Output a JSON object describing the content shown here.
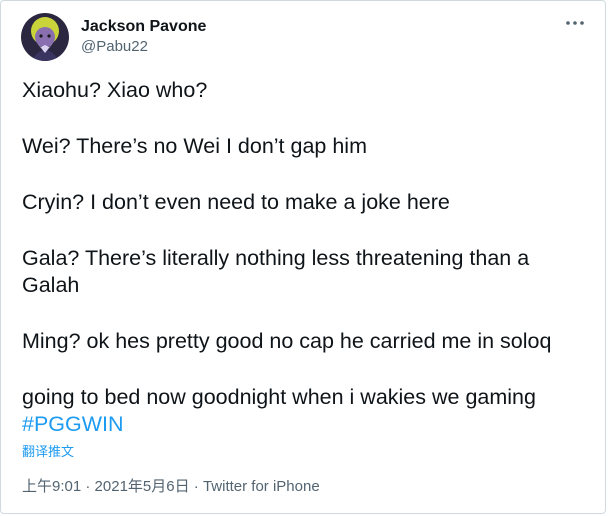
{
  "author": {
    "display_name": "Jackson Pavone",
    "handle": "@Pabu22"
  },
  "tweet": {
    "paragraphs": [
      "Xiaohu? Xiao who?",
      "Wei? There’s no Wei I don’t gap him",
      "Cryin? I don’t even need to make a joke here",
      "Gala? There’s literally nothing less threatening than a Galah",
      "Ming? ok hes pretty good no cap he carried me in soloq"
    ],
    "last_paragraph_text": "going to bed now goodnight when i wakies we gaming",
    "hashtag": "#PGGWIN"
  },
  "translate_label": "翻译推文",
  "meta": {
    "time": "上午9:01",
    "separator": " · ",
    "date": "2021年5月6日",
    "source": "Twitter for iPhone"
  },
  "icons": {
    "more": "more-horizontal-icon",
    "avatar": "avatar-image"
  },
  "colors": {
    "link": "#1d9bf0",
    "secondary_text": "#536471",
    "primary_text": "#0f1419"
  }
}
